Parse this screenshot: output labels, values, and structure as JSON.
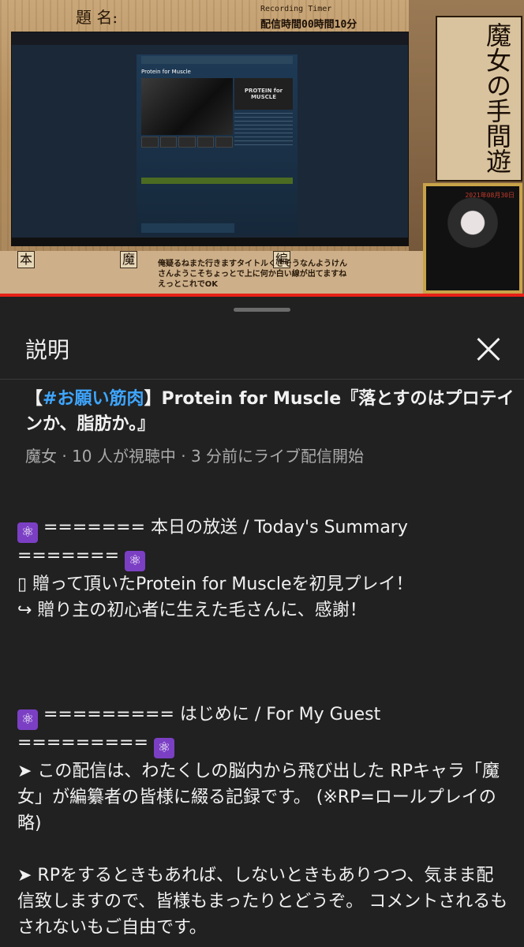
{
  "video": {
    "overlay_title": "題 名:",
    "recording_label": "Recording Timer",
    "recording_time": "配信時間00時間10分",
    "steam_game_title": "Protein for Muscle",
    "steam_capsule_text": "PROTEIN for MUSCLE",
    "logo_text": "魔女の手間遊",
    "date_tag": "2021年08月30日",
    "label_hon": "本",
    "label_majo": "魔",
    "label_hen": "編",
    "chat_text": "俺疑るねまた行きますタイトルくさそうなんようけん さんようこそちょっとで上に何か白い線が出てますね えっとこれでOK"
  },
  "sheet": {
    "title": "説明",
    "close_icon": "close-icon"
  },
  "video_info": {
    "title_prefix": "【",
    "hashtag": "#お願い筋肉",
    "title_rest": "】Protein for Muscle『落とすのはプロテインか、脂肪か。』",
    "meta": "魔女 · 10 人が視聴中 · 3 分前にライブ配信開始"
  },
  "description": {
    "atom_glyph": "⚛",
    "summary_header": " ======= 本日の放送 / Today's Summary ======= ",
    "summary_line1": "▯ 贈って頂いたProtein for Muscleを初見プレイ！",
    "summary_line2": " ↪ 贈り主の初心者に生えた毛さんに、感謝！",
    "guest_header": " ========= はじめに / For My Guest ========= ",
    "guest_line1": "➤ この配信は、わたくしの脳内から飛び出した RPキャラ「魔女」が編纂者の皆様に綴る記録です。 (※RP=ロールプレイの略)",
    "guest_line2": "➤ RPをするときもあれば、しないときもありつつ、気まま配信致しますので、皆様もまったりとどうぞ。 コメントされるもされないもご自由です。"
  }
}
